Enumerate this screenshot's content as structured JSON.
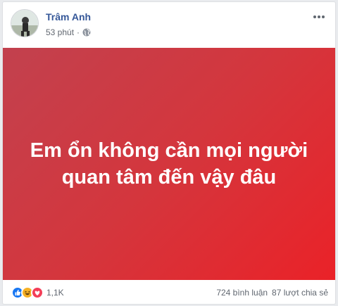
{
  "post": {
    "author": "Trâm Anh",
    "time": "53 phút",
    "separator": "·",
    "privacy_icon": "globe-icon",
    "more_icon": "more-horizontal-icon",
    "text": "Em ổn không cần mọi người quan tâm đến vậy đâu",
    "background_colors": [
      "#c2414e",
      "#ea2228"
    ]
  },
  "footer": {
    "reactions": [
      "like-icon",
      "haha-icon",
      "love-icon"
    ],
    "reaction_count": "1,1K",
    "comments": "724 bình luận",
    "shares": "87 lượt chia sẻ"
  }
}
